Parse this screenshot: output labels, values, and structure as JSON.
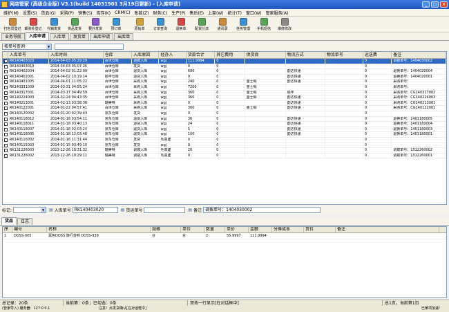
{
  "window": {
    "title": "网店管家 (高级企业版)  V3.1(build 14031901 3月19日更新) - [入库申请]"
  },
  "menu": [
    "维护(M)",
    "设置(S)",
    "货品(G)",
    "采购(P)",
    "销售(S)",
    "库存(K)",
    "CRM(C)",
    "账款(Z)",
    "财务(C)",
    "生产(P)",
    "售后(E)",
    "上架(W)",
    "统计(T)",
    "窗口(W)",
    "管家服务(A)"
  ],
  "toolbar": [
    {
      "label": "打包员登记",
      "icon": "package-icon",
      "color": "#c98a3e"
    },
    {
      "label": "邮资补登记",
      "icon": "stamp-icon",
      "color": "#d04a4a"
    },
    {
      "label": "代销发货",
      "icon": "truck-icon",
      "color": "#3e8ed0"
    },
    {
      "label": "货品发货",
      "icon": "box-send-icon",
      "color": "#5aa35a"
    },
    {
      "label": "要外发货",
      "icon": "export-icon",
      "color": "#8a5ac9"
    },
    {
      "label": "预订单",
      "icon": "order-icon",
      "color": "#3e8ed0"
    },
    {
      "label": "",
      "icon": "",
      "color": ""
    },
    {
      "label": "原始单",
      "icon": "doc-icon",
      "color": "#d0a23e"
    },
    {
      "label": "订单查询",
      "icon": "search-doc-icon",
      "color": "#3e8ed0"
    },
    {
      "label": "退换单",
      "icon": "return-icon",
      "color": "#d04a4a"
    },
    {
      "label": "配货分流",
      "icon": "split-icon",
      "color": "#5aa35a"
    },
    {
      "label": "通讯录",
      "icon": "contacts-icon",
      "color": "#c98a3e"
    },
    {
      "label": "任务管理",
      "icon": "tasks-icon",
      "color": "#3e8ed0"
    },
    {
      "label": "手机短信",
      "icon": "sms-icon",
      "color": "#5aa35a"
    },
    {
      "label": "维修修改",
      "icon": "wrench-icon",
      "color": "#8a8a8a"
    }
  ],
  "tabs": [
    "业务导航",
    "入库申请",
    "入库单",
    "发货单",
    "出库申请",
    "出库单"
  ],
  "active_tab_index": 1,
  "filter": {
    "value": "按单号查询"
  },
  "grid": {
    "columns": [
      "入库单号",
      "入库时间",
      "仓库",
      "入库原因",
      "经办人",
      "货款合计",
      "其它费用",
      "供货商",
      "物流方式",
      "物流单号",
      "运送费",
      "备注"
    ],
    "rows": [
      [
        "RK140403020",
        "2014-04-03 05:29:29",
        "百世仓库",
        "调拨入库",
        "wgj",
        "111.9994",
        "0",
        "",
        "",
        "",
        "0",
        "调拨单号：1404030002"
      ],
      [
        "RK140403019",
        "2014-04-03 05:07:26",
        "百世仓库",
        "发货",
        "wgj",
        "0",
        "0",
        "",
        "",
        "",
        "0",
        ""
      ],
      [
        "RK140402004",
        "2014-04-02 01:22:09",
        "百世仓库",
        "退货入库",
        "wgj",
        "690",
        "0",
        "",
        "韵达快递",
        "",
        "0",
        "退换单号：1404020004"
      ],
      [
        "RK140402001",
        "2014-04-02 10:19:14",
        "顺丰仓库",
        "退货入库",
        "wgj",
        "0",
        "0",
        "",
        "韵达快递",
        "",
        "0",
        "退换单号：1404020001"
      ],
      [
        "RK140401005",
        "2014-04-01 11:05:22",
        "百世仓库",
        "采购入库",
        "wgj",
        "240",
        "0",
        "金士顿",
        "韵达快递",
        "",
        "0",
        "采购单号："
      ],
      [
        "RK140331009",
        "2014-03-31 04:55:24",
        "百世仓库",
        "采购入库",
        "wgj",
        "7200",
        "0",
        "金士顿",
        "",
        "",
        "0",
        "采购单号："
      ],
      [
        "RK140317001",
        "2014-03-17 04:49:59",
        "百世仓库",
        "采购入库",
        "wgj",
        "360",
        "0",
        "金士顿",
        "顺丰",
        "",
        "0",
        "采购单号：CG140317002"
      ],
      [
        "RK140224003",
        "2014-02-24 04:43:35",
        "百世仓库",
        "采购入库",
        "wgj",
        "360",
        "0",
        "金士顿",
        "韵达快递",
        "",
        "0",
        "采购单号：CG140224003"
      ],
      [
        "RK140213001",
        "2014-02-13 03:38:36",
        "瑞美特",
        "采购入库",
        "wgj",
        "0",
        "0",
        "",
        "韵达快递",
        "",
        "0",
        "采购单号：CG140213001"
      ],
      [
        "RK140122001",
        "2014-01-22 04:57:41",
        "百世仓库",
        "采购入库",
        "wgj",
        "300",
        "0",
        "金士顿",
        "韵达快递",
        "",
        "0",
        "采购单号：CG140122001"
      ],
      [
        "RK140120002",
        "2014-01-20 02:39:43",
        "京东仓库",
        "发货",
        "wgj",
        "0",
        "0",
        "",
        "",
        "",
        "0",
        ""
      ],
      [
        "RK140118012",
        "2014-01-18 03:54:11",
        "京东仓库",
        "退货入库",
        "wgj",
        "36",
        "0",
        "",
        "韵达快递",
        "",
        "0",
        "退换单号：1401180005"
      ],
      [
        "RK140118011",
        "2014-01-18 03:40:13",
        "京东仓库",
        "退货入库",
        "wgj",
        "24",
        "0",
        "",
        "韵达快递",
        "",
        "0",
        "退换单号：1401180004"
      ],
      [
        "RK140118007",
        "2014-01-18 02:03:24",
        "京东仓库",
        "退货入库",
        "wgj",
        "5",
        "0",
        "",
        "韵达快递",
        "",
        "0",
        "退换单号：1401180003"
      ],
      [
        "RK140118005",
        "2014-01-18 12:03:48",
        "京东仓库",
        "退货入库",
        "wgj",
        "100",
        "0",
        "",
        "韵达快递",
        "",
        "0",
        "退换单号：1401180001"
      ],
      [
        "RK140116002",
        "2014-01-16 11:31:44",
        "京东仓库",
        "发货",
        "毛高建",
        "0",
        "0",
        "",
        "",
        "",
        "0",
        ""
      ],
      [
        "RK140115003",
        "2014-01-15 03:49:10",
        "京东仓库",
        "发货",
        "wgj",
        "0",
        "0",
        "",
        "",
        "",
        "0",
        ""
      ],
      [
        "RK131226003",
        "2013-12-26 10:31:32",
        "瑞美特",
        "调拨入库",
        "毛高建",
        "20",
        "0",
        "",
        "",
        "",
        "0",
        "调拨单号：1312260002"
      ],
      [
        "RK131226002",
        "2013-12-26 10:29:11",
        "瑞美特",
        "调拨入库",
        "毛高建",
        "0",
        "0",
        "",
        "",
        "",
        "0",
        "调拨单号：1312260001"
      ]
    ]
  },
  "detail_bar": {
    "tag_label": "标记:",
    "inbound_label": "入库单号",
    "inbound_value": "RK140403020",
    "ship_label": "货运单号",
    "remark_label": "备注",
    "remark_value": "调拨单号：1404030002"
  },
  "detail_tabs": [
    "货品",
    "日志"
  ],
  "detail_grid": {
    "columns": [
      "序",
      "编号",
      "名称",
      "规格",
      "单位",
      "数量",
      "单价",
      "金额",
      "分摊成本",
      "货位",
      "备注"
    ],
    "rows": [
      [
        "1",
        "DOSS-005",
        "黑色DOSS 旅行音响 DOSS-938",
        "台",
        "台",
        "2",
        "55.9997",
        "111.9994",
        "",
        "",
        ""
      ]
    ]
  },
  "status": {
    "total": "总记录：20条",
    "current": "当前第：0条；已勾选：0条",
    "hint": "双击一行显示[在对话框中]",
    "page": "总1页，当前第1页"
  },
  "status2": {
    "left": "(管家导入) 服务器：127.0.0.1",
    "mid": "注意！点发货确认[在对话框中]",
    "right": "已某项加速!"
  }
}
